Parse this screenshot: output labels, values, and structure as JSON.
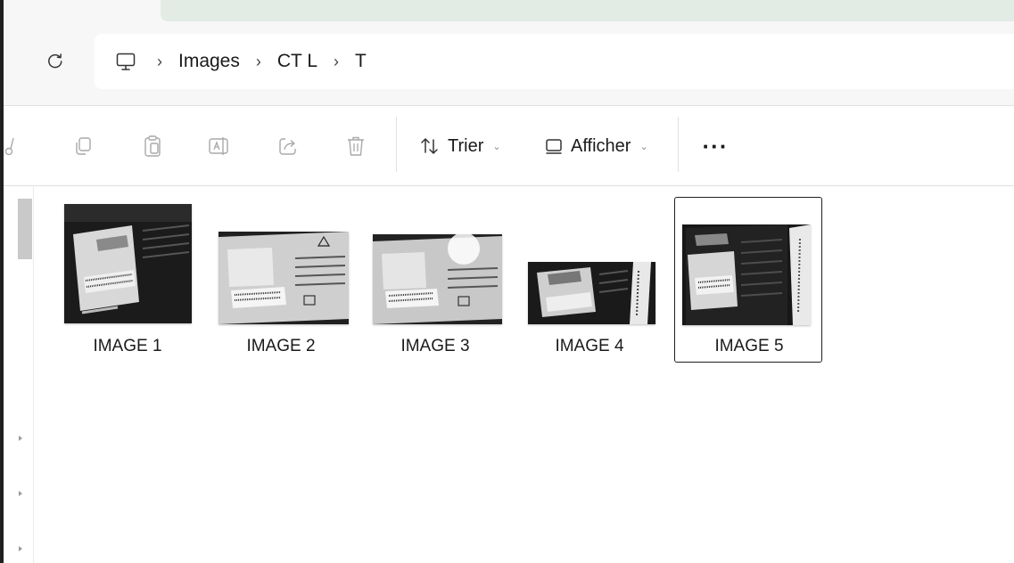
{
  "window": {
    "tab_bar_color": "#e3ebe5"
  },
  "navigation": {
    "refresh_icon": "refresh-icon",
    "this_pc_icon": "computer-icon",
    "breadcrumbs": [
      "Images",
      "CT L",
      "T"
    ],
    "separator": "›"
  },
  "toolbar": {
    "actions": [
      {
        "name": "cut",
        "icon": "scissors-icon"
      },
      {
        "name": "copy",
        "icon": "copy-icon"
      },
      {
        "name": "paste",
        "icon": "paste-icon"
      },
      {
        "name": "rename",
        "icon": "rename-icon"
      },
      {
        "name": "share",
        "icon": "share-icon"
      },
      {
        "name": "delete",
        "icon": "trash-icon"
      }
    ],
    "sort_label": "Trier",
    "view_label": "Afficher",
    "more_label": "···"
  },
  "files": [
    {
      "name": "IMAGE 1",
      "selected": false
    },
    {
      "name": "IMAGE 2",
      "selected": false
    },
    {
      "name": "IMAGE 3",
      "selected": false
    },
    {
      "name": "IMAGE 4",
      "selected": false
    },
    {
      "name": "IMAGE 5",
      "selected": true
    }
  ],
  "colors": {
    "toolbar_bg": "#ffffff",
    "header_bg": "#f7f7f7",
    "selection_border": "#1f1f1f"
  }
}
